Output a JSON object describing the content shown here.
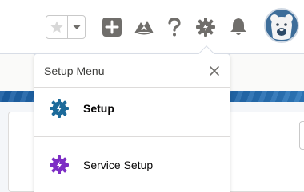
{
  "header": {
    "favorites_icon": "star-icon",
    "favorites_menu_icon": "chevron-down-icon",
    "new_icon": "plus-icon",
    "trailhead_icon": "trailhead-icon",
    "help_icon": "question-icon",
    "setup_icon": "gear-icon",
    "notifications_icon": "bell-icon",
    "avatar_icon": "bear-avatar-icon"
  },
  "setup_menu": {
    "title": "Setup Menu",
    "close_icon": "close-icon",
    "items": [
      {
        "label": "Setup",
        "icon": "gear-icon",
        "icon_color": "#1c6a9a",
        "bold": true
      },
      {
        "label": "Service Setup",
        "icon": "gear-icon",
        "icon_color": "#7d2ec5",
        "bold": false
      }
    ]
  },
  "colors": {
    "icon_gray": "#706e6b",
    "band_blue": "#1f63a6",
    "avatar_bg": "#3d6d99"
  }
}
